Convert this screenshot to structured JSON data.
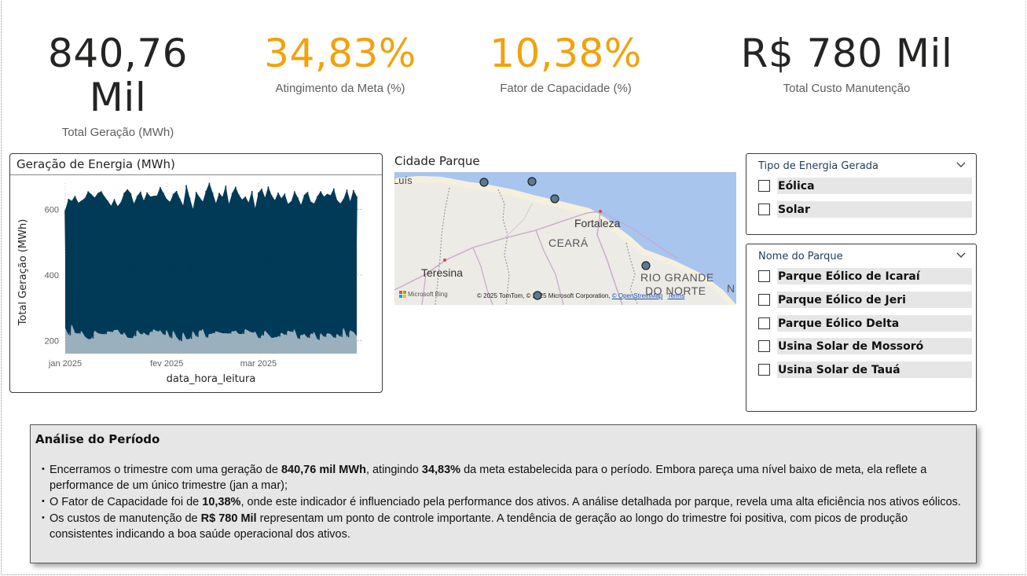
{
  "kpis": [
    {
      "value": "840,76 Mil",
      "label": "Total Geração (MWh)",
      "color": "#252423"
    },
    {
      "value": "34,83%",
      "label": "Atingimento da Meta (%)",
      "color": "#f2a20c"
    },
    {
      "value": "10,38%",
      "label": "Fator de Capacidade (%)",
      "color": "#f2a20c"
    },
    {
      "value": "R$ 780 Mil",
      "label": "Total Custo Manutenção",
      "color": "#252423"
    }
  ],
  "chart": {
    "title": "Geração de Energia (MWh)"
  },
  "chart_data": {
    "type": "area",
    "title": "Geração de Energia (MWh)",
    "xlabel": "data_hora_leitura",
    "ylabel": "Total Geração (MWh)",
    "x_tick_labels": [
      "jan 2025",
      "fev 2025",
      "mar 2025"
    ],
    "y_tick_labels": [
      "200",
      "400",
      "600"
    ],
    "x_range": [
      "2025-01-01",
      "2025-03-31"
    ],
    "ylim": [
      160,
      680
    ],
    "series": [
      {
        "color": "#003a57",
        "fill": "#9ab0bc",
        "daily_peak": [
          598,
          632,
          626,
          641,
          620,
          627,
          634,
          655,
          646,
          636,
          650,
          655,
          639,
          626,
          611,
          631,
          610,
          622,
          650,
          661,
          649,
          618,
          641,
          654,
          627,
          652,
          639,
          641,
          642,
          668,
          650,
          631,
          623,
          647,
          656,
          633,
          612,
          674,
          636,
          602,
          653,
          637,
          624,
          656,
          681,
          651,
          619,
          650,
          638,
          672,
          617,
          650,
          669,
          645,
          630,
          639,
          621,
          656,
          604,
          651,
          663,
          636,
          670,
          643,
          628,
          651,
          634,
          648,
          617,
          624,
          655,
          636,
          614,
          644,
          653,
          623,
          618,
          640,
          655,
          639,
          647,
          643,
          664,
          628,
          618,
          632,
          660,
          625,
          659,
          640
        ],
        "daily_low": [
          238,
          216,
          249,
          223,
          221,
          229,
          212,
          204,
          206,
          230,
          222,
          220,
          219,
          228,
          226,
          232,
          233,
          218,
          224,
          209,
          207,
          213,
          232,
          219,
          224,
          216,
          226,
          234,
          228,
          231,
          217,
          232,
          207,
          230,
          210,
          198,
          225,
          204,
          205,
          229,
          211,
          230,
          235,
          209,
          220,
          222,
          228,
          225,
          222,
          222,
          221,
          228,
          230,
          220,
          220,
          235,
          229,
          224,
          227,
          207,
          215,
          230,
          219,
          208,
          210,
          212,
          224,
          217,
          230,
          226,
          234,
          205,
          217,
          220,
          208,
          220,
          226,
          202,
          222,
          211,
          222,
          220,
          208,
          220,
          211,
          239,
          210,
          231,
          226,
          213
        ]
      }
    ],
    "grid": "horizontal dotted",
    "legend": "none"
  },
  "map": {
    "title": "Cidade Parque",
    "labels": {
      "luis": "Luís",
      "fortaleza": "Fortaleza",
      "ceara": "CEARÁ",
      "teresina": "Teresina",
      "rio_grande_1": "RIO GRANDE",
      "rio_grande_2": "DO NORTE",
      "n_edge": "N"
    },
    "attribution_prefix": "© 2025 TomTom, © 2025 Microsoft Corporation,",
    "attribution_link": "© OpenStreetMap",
    "attribution_terms": "Terms",
    "bing_logo": "Microsoft Bing",
    "marker_color": "#5b7a8f"
  },
  "slicers": {
    "energy_type": {
      "title": "Tipo de Energia Gerada",
      "items": [
        "Eólica",
        "Solar"
      ]
    },
    "park_name": {
      "title": "Nome do Parque",
      "items": [
        "Parque Eólico de Icaraí",
        "Parque Eólico de Jeri",
        "Parque Eólico Delta",
        "Usina Solar de Mossoró",
        "Usina Solar de Tauá"
      ]
    }
  },
  "analysis": {
    "title": "Análise do Período",
    "bullet1": {
      "a": "Encerramos o trimestre com uma geração de ",
      "b": "840,76 mil MWh",
      "c": ", atingindo ",
      "d": "34,83%",
      "e": " da meta estabelecida para o período. Embora pareça uma nível baixo de meta, ela reflete a performance de um único trimestre (jan a mar);"
    },
    "bullet2": {
      "a": "O Fator de Capacidade foi de ",
      "b": "10,38%",
      "c": ", onde este indicador é influenciado pela performance dos ativos. A análise detalhada por parque, revela uma alta eficiência nos ativos eólicos."
    },
    "bullet3": {
      "a": "Os custos de manutenção de ",
      "b": "R$ 780 Mil",
      "c": " representam um ponto de controle importante. A tendência de geração ao longo do trimestre foi positiva, com picos de produção consistentes indicando a boa saúde operacional dos ativos."
    }
  }
}
